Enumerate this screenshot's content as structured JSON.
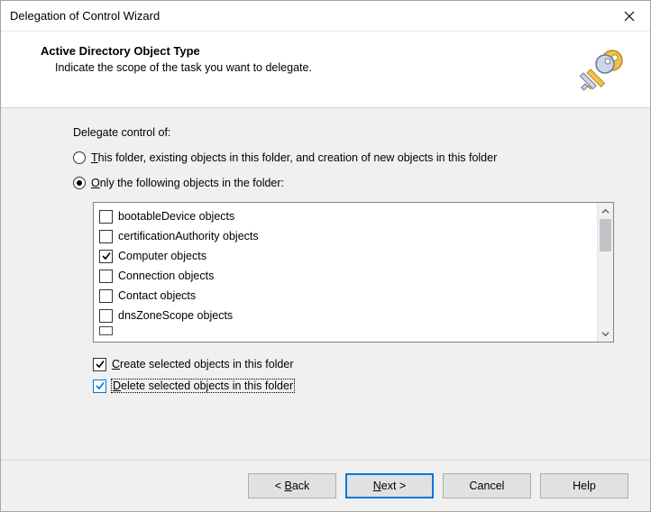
{
  "window": {
    "title": "Delegation of Control Wizard"
  },
  "header": {
    "heading": "Active Directory Object Type",
    "sub": "Indicate the scope of the task you want to delegate."
  },
  "content": {
    "scope_label": "Delegate control of:",
    "radio1_pre": "",
    "radio1_m": "T",
    "radio1_post": "his folder, existing objects in this folder, and creation of new objects in this folder",
    "radio2_m": "O",
    "radio2_post": "nly the following objects in the folder:",
    "selected_radio": 1,
    "object_types": [
      {
        "label": "bootableDevice objects",
        "checked": false
      },
      {
        "label": "certificationAuthority objects",
        "checked": false
      },
      {
        "label": "Computer objects",
        "checked": true
      },
      {
        "label": "Connection objects",
        "checked": false
      },
      {
        "label": "Contact objects",
        "checked": false
      },
      {
        "label": "dnsZoneScope objects",
        "checked": false
      }
    ],
    "create_m": "C",
    "create_post": "reate selected objects in this folder",
    "create_checked": true,
    "delete_m": "D",
    "delete_post": "elete selected objects in this folder",
    "delete_checked": true
  },
  "buttons": {
    "back_pre": "< ",
    "back_m": "B",
    "back_post": "ack",
    "next_m": "N",
    "next_post": "ext >",
    "cancel": "Cancel",
    "help": "Help"
  }
}
